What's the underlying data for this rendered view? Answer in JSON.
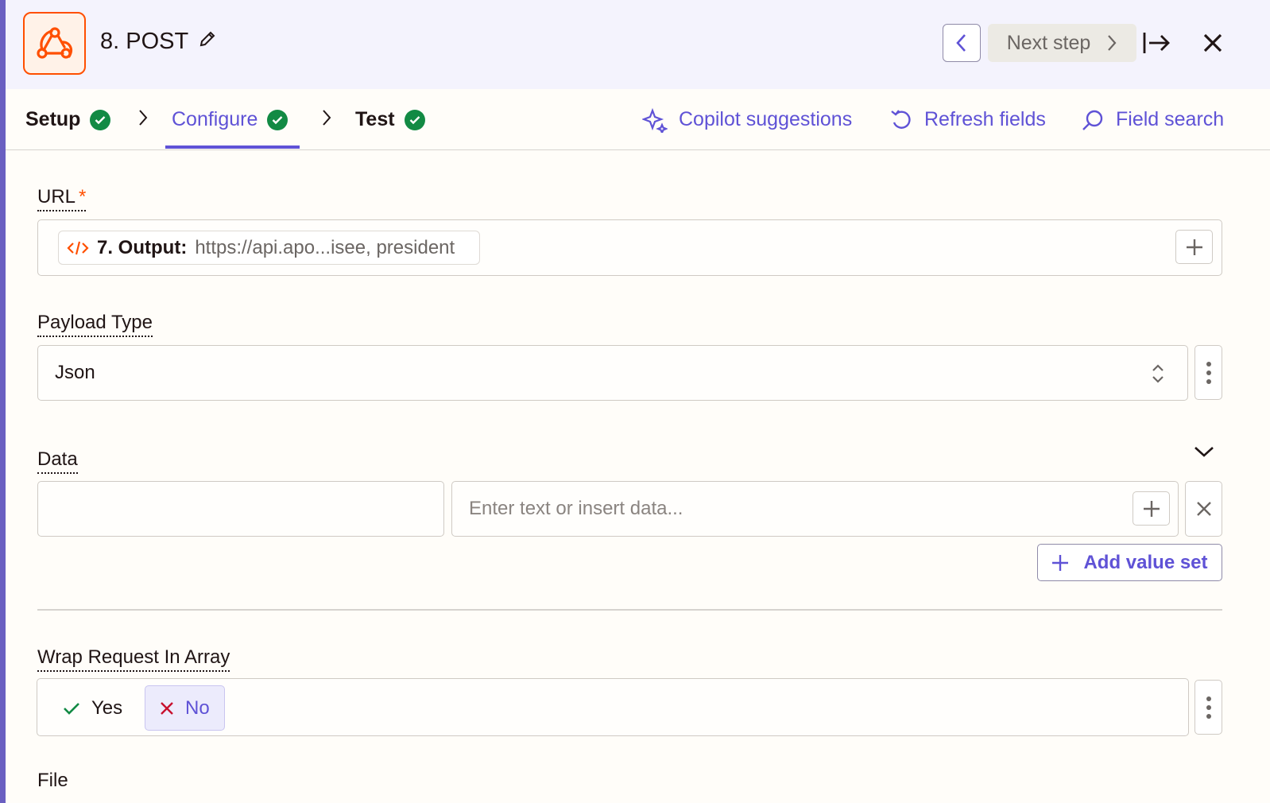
{
  "header": {
    "step_title": "8. POST",
    "app_icon": "webhook-icon",
    "next_step_label": "Next step",
    "brand_color": "#ff4f00"
  },
  "tabs": [
    {
      "label": "Setup",
      "status": "complete"
    },
    {
      "label": "Configure",
      "status": "complete",
      "active": true
    },
    {
      "label": "Test",
      "status": "complete"
    }
  ],
  "toolbar": {
    "copilot_label": "Copilot suggestions",
    "refresh_label": "Refresh fields",
    "search_label": "Field search"
  },
  "fields": {
    "url": {
      "label": "URL",
      "required_mark": "*",
      "chip_key": "7. Output:",
      "chip_value": "https://api.apo...isee, president"
    },
    "payload_type": {
      "label": "Payload Type",
      "value": "Json"
    },
    "data": {
      "label": "Data",
      "key_value": "",
      "value_placeholder": "Enter text or insert data...",
      "add_value_set_label": "Add value set"
    },
    "wrap_request": {
      "label": "Wrap Request In Array",
      "yes_label": "Yes",
      "no_label": "No",
      "selected": "No"
    },
    "file": {
      "label": "File"
    }
  },
  "colors": {
    "accent": "#5f52d6",
    "success": "#128a44"
  }
}
